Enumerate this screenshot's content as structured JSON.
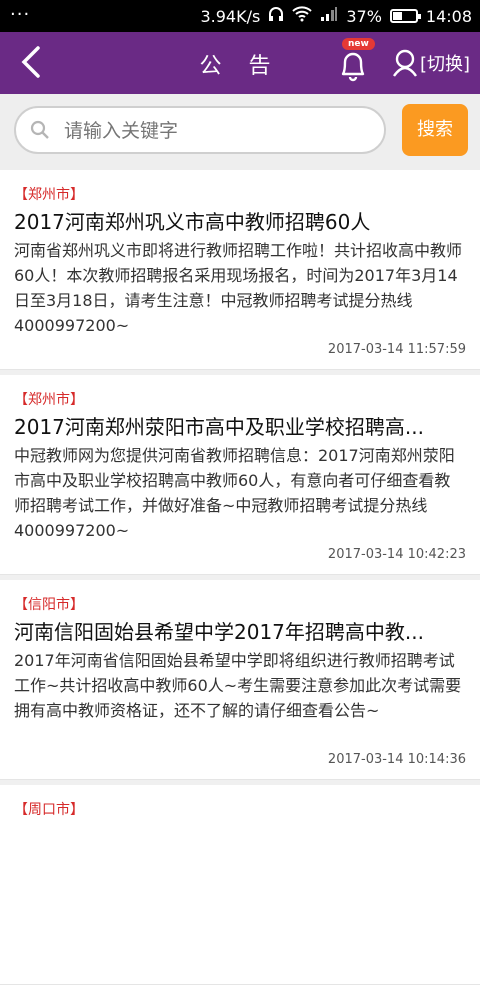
{
  "status_bar": {
    "left": "···",
    "speed": "3.94K/s",
    "battery": "37%",
    "time": "14:08"
  },
  "header": {
    "back": "back",
    "title": "公 告",
    "badge": "new",
    "switch_label": "[切换]"
  },
  "search": {
    "placeholder": "请输入关键字",
    "button": "搜索"
  },
  "notices": [
    {
      "city": "【郑州市】",
      "title": "2017河南郑州巩义市高中教师招聘60人",
      "summary": "河南省郑州巩义市即将进行教师招聘工作啦！共计招收高中教师60人！本次教师招聘报名采用现场报名，时间为2017年3月14日至3月18日，请考生注意！中冠教师招聘考试提分热线4000997200~",
      "date": "2017-03-14 11:57:59"
    },
    {
      "city": "【郑州市】",
      "title": "2017河南郑州荥阳市高中及职业学校招聘高...",
      "summary": "中冠教师网为您提供河南省教师招聘信息：2017河南郑州荥阳市高中及职业学校招聘高中教师60人，有意向者可仔细查看教师招聘考试工作，并做好准备~中冠教师招聘考试提分热线4000997200~",
      "date": "2017-03-14 10:42:23"
    },
    {
      "city": "【信阳市】",
      "title": "河南信阳固始县希望中学2017年招聘高中教...",
      "summary": "2017年河南省信阳固始县希望中学即将组织进行教师招聘考试工作~共计招收高中教师60人~考生需要注意参加此次考试需要拥有高中教师资格证，还不了解的请仔细查看公告~",
      "date": "2017-03-14 10:14:36"
    },
    {
      "city": "【周口市】",
      "title": "",
      "summary": "",
      "date": ""
    }
  ],
  "colors": {
    "header": "#6a2a85",
    "accent": "#fb9a21",
    "city": "#d62a2a"
  }
}
